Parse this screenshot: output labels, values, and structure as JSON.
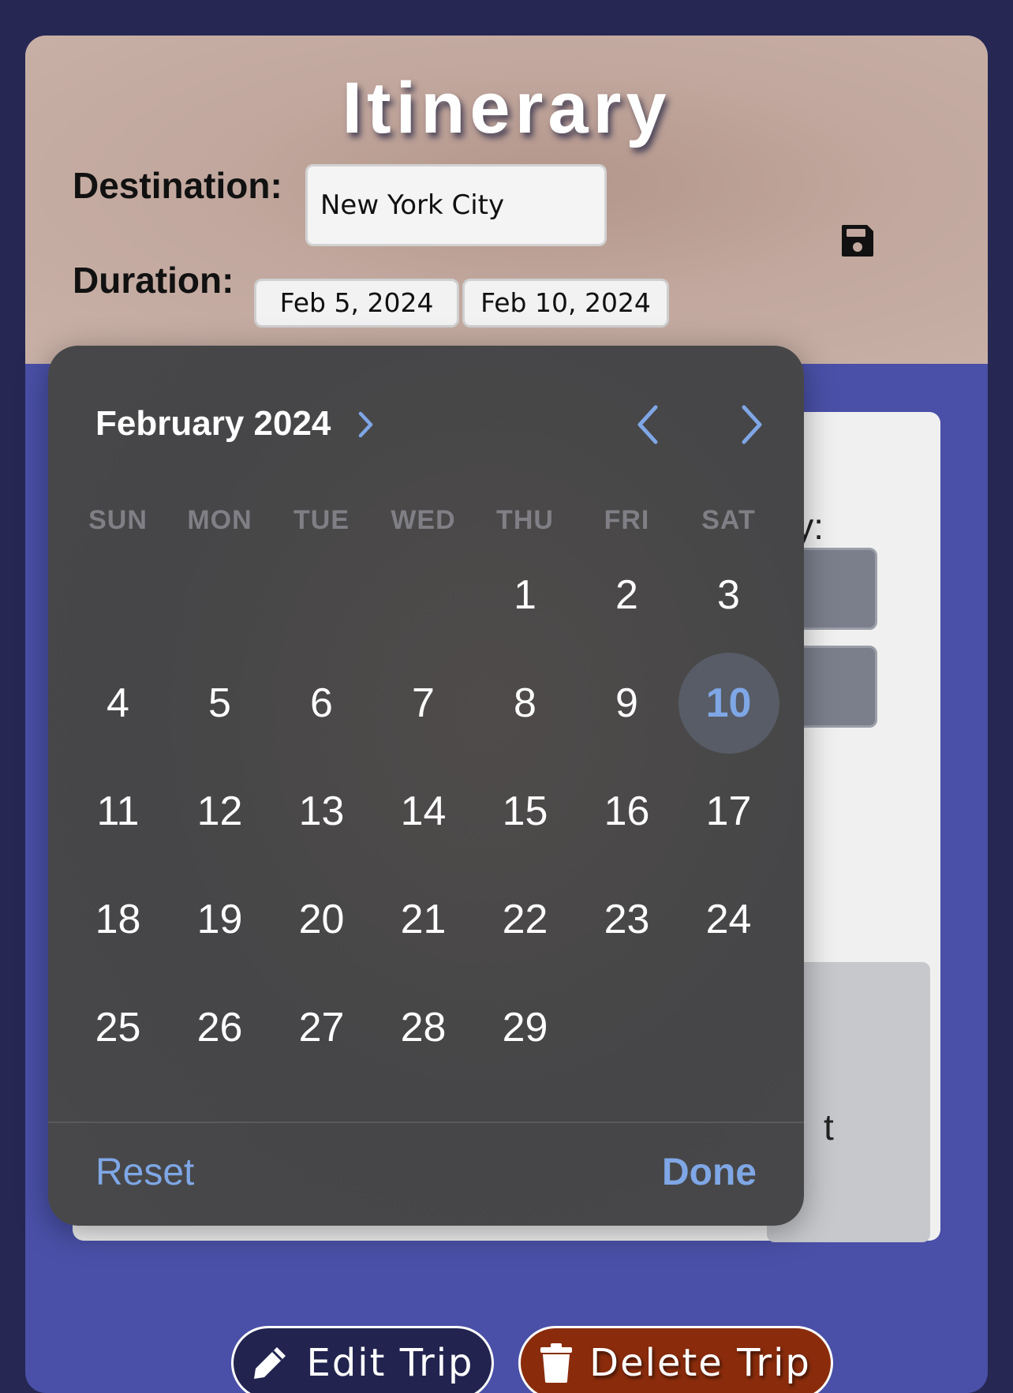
{
  "header": {
    "title": "Itinerary"
  },
  "destination": {
    "label": "Destination:",
    "value": "New York City"
  },
  "duration": {
    "label": "Duration:",
    "start": "Feb 5, 2024",
    "end": "Feb 10, 2024"
  },
  "background_panel": {
    "partial_text_1": "rary:",
    "partial_text_2": "t"
  },
  "actions": {
    "edit_label": "Edit Trip",
    "delete_label": "Delete Trip"
  },
  "calendar": {
    "month_label": "February 2024",
    "weekdays": [
      "SUN",
      "MON",
      "TUE",
      "WED",
      "THU",
      "FRI",
      "SAT"
    ],
    "first_weekday_index": 4,
    "days_in_month": 29,
    "selected_day": 10,
    "reset_label": "Reset",
    "done_label": "Done"
  },
  "colors": {
    "page_bg": "#262753",
    "card_bg": "#4a50a7",
    "header_bg": "#c1a79d",
    "calendar_bg": "#48484a",
    "accent_blue": "#7fa7e6",
    "edit_button": "#22244f",
    "delete_button": "#8a2c0c"
  },
  "icons": {
    "save": "floppy-disk-icon",
    "edit": "pencil-icon",
    "delete": "trash-icon",
    "month_expand": "chevron-right-icon",
    "prev": "chevron-left-icon",
    "next": "chevron-right-icon"
  }
}
